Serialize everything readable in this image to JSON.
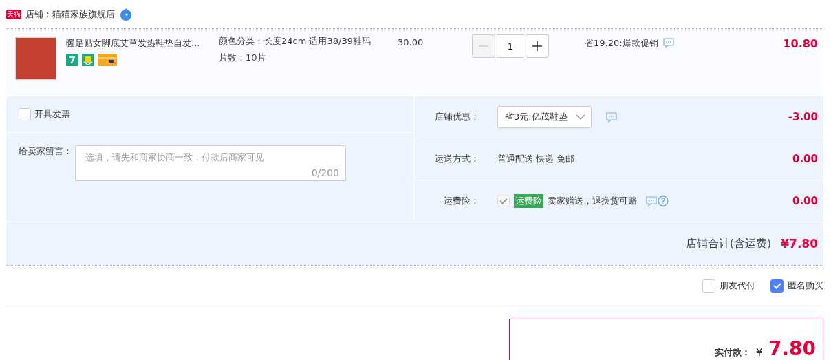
{
  "store": {
    "badge": "天猫",
    "label": "店铺：猫猫家族旗舰店"
  },
  "item": {
    "title": "暖足贴女脚底艾草发热鞋垫自发...",
    "service_badges": [
      {
        "kind": "seven-day",
        "label": "7"
      },
      {
        "kind": "shield"
      },
      {
        "kind": "card"
      }
    ],
    "specs": [
      "颜色分类：长度24cm 适用38/39鞋码",
      "片数：10片"
    ],
    "price": "30.00",
    "quantity": "1",
    "minus_disabled": true,
    "promo": "省19.20:爆款促销",
    "subtotal": "10.80"
  },
  "invoice": {
    "label": "开具发票",
    "checked": false
  },
  "message": {
    "label": "给卖家留言：",
    "placeholder": "选填，请先和商家协商一致，付款后商家可见",
    "counter": "0/200"
  },
  "fees": [
    {
      "kind": "select",
      "label": "店铺优惠：",
      "value": "省3元:亿茂鞋垫",
      "amount": "-3.00"
    },
    {
      "kind": "text",
      "label": "运送方式：",
      "value": "普通配送 快递 免邮",
      "amount": "0.00"
    },
    {
      "kind": "insurance",
      "label": "运费险：",
      "checked": true,
      "disabled": true,
      "tag": "运费险",
      "value": "卖家赠送，退换货可赔",
      "amount": "0.00"
    }
  ],
  "total": {
    "label": "店铺合计(含运费)",
    "amount": "¥7.80"
  },
  "options": [
    {
      "label": "朋友代付",
      "checked": false
    },
    {
      "label": "匿名购买",
      "checked": true
    }
  ],
  "pay": {
    "label": "实付款：",
    "currency": "¥",
    "amount": "7.80"
  }
}
